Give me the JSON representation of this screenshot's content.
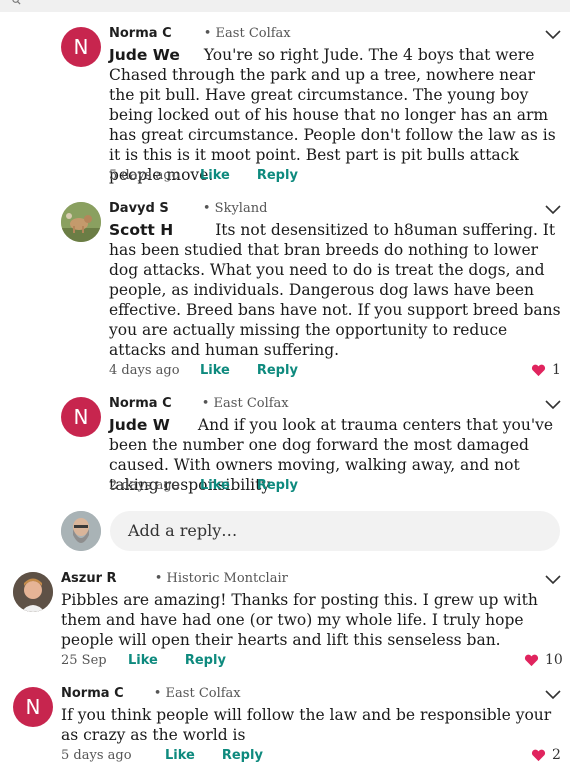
{
  "comments": [
    {
      "author": "Norma C",
      "neighborhood": "• East Colfax",
      "avatar_letter": "N",
      "mention": "Jude We",
      "text": "You're so right Jude. The 4 boys that were Chased through the park and up a tree, nowhere near the pit bull. Have great circumstance. The young boy being locked out of his house that no longer has an arm has great circumstance. People don't follow the law as is it is this is it moot point.  Best part is pit bulls attack people move.",
      "time": "5 days ago",
      "like_label": "Like",
      "reply_label": "Reply"
    },
    {
      "author": "Davyd S",
      "neighborhood": "• Skyland",
      "avatar_icon": "dog-photo",
      "mention": "Scott H",
      "text": "Its not desensitized to h8uman suffering.  It has been studied that bran breeds do nothing to lower dog attacks.  What you need to do is treat the dogs, and people, as individuals.  Dangerous dog laws have been effective.  Breed bans have not.  If you support breed bans you are actually missing the opportunity to reduce attacks and human suffering.",
      "time": "4 days ago",
      "like_label": "Like",
      "reply_label": "Reply",
      "likes": "1"
    },
    {
      "author": "Norma C",
      "neighborhood": "• East Colfax",
      "avatar_letter": "N",
      "mention": "Jude W",
      "text": "And if you look at trauma centers that you've been the number one dog forward the most damaged caused. With owners moving, walking away, and not taking responsibility",
      "time": "2 days ago",
      "like_label": "Like",
      "reply_label": "Reply"
    },
    {
      "author": "Aszur R",
      "neighborhood": "• Historic Montclair",
      "avatar_icon": "person-photo",
      "text": "Pibbles are amazing! Thanks for posting this. I grew up with them and have had one (or two) my whole life. I truly hope people will open their hearts and lift this senseless ban.",
      "time": "25 Sep",
      "like_label": "Like",
      "reply_label": "Reply",
      "likes": "10"
    },
    {
      "author": "Norma C",
      "neighborhood": "• East Colfax",
      "avatar_letter": "N",
      "text": "If you think people will follow the law and be responsible your as crazy as the world is",
      "time": "5 days ago",
      "like_label": "Like",
      "reply_label": "Reply",
      "likes": "2"
    }
  ],
  "reply_box": {
    "placeholder": "Add a reply…",
    "avatar_icon": "bearded-man-photo"
  },
  "colors": {
    "accent": "#0e8a7e",
    "avatar": "#c7254e",
    "heart": "#e0245e"
  }
}
